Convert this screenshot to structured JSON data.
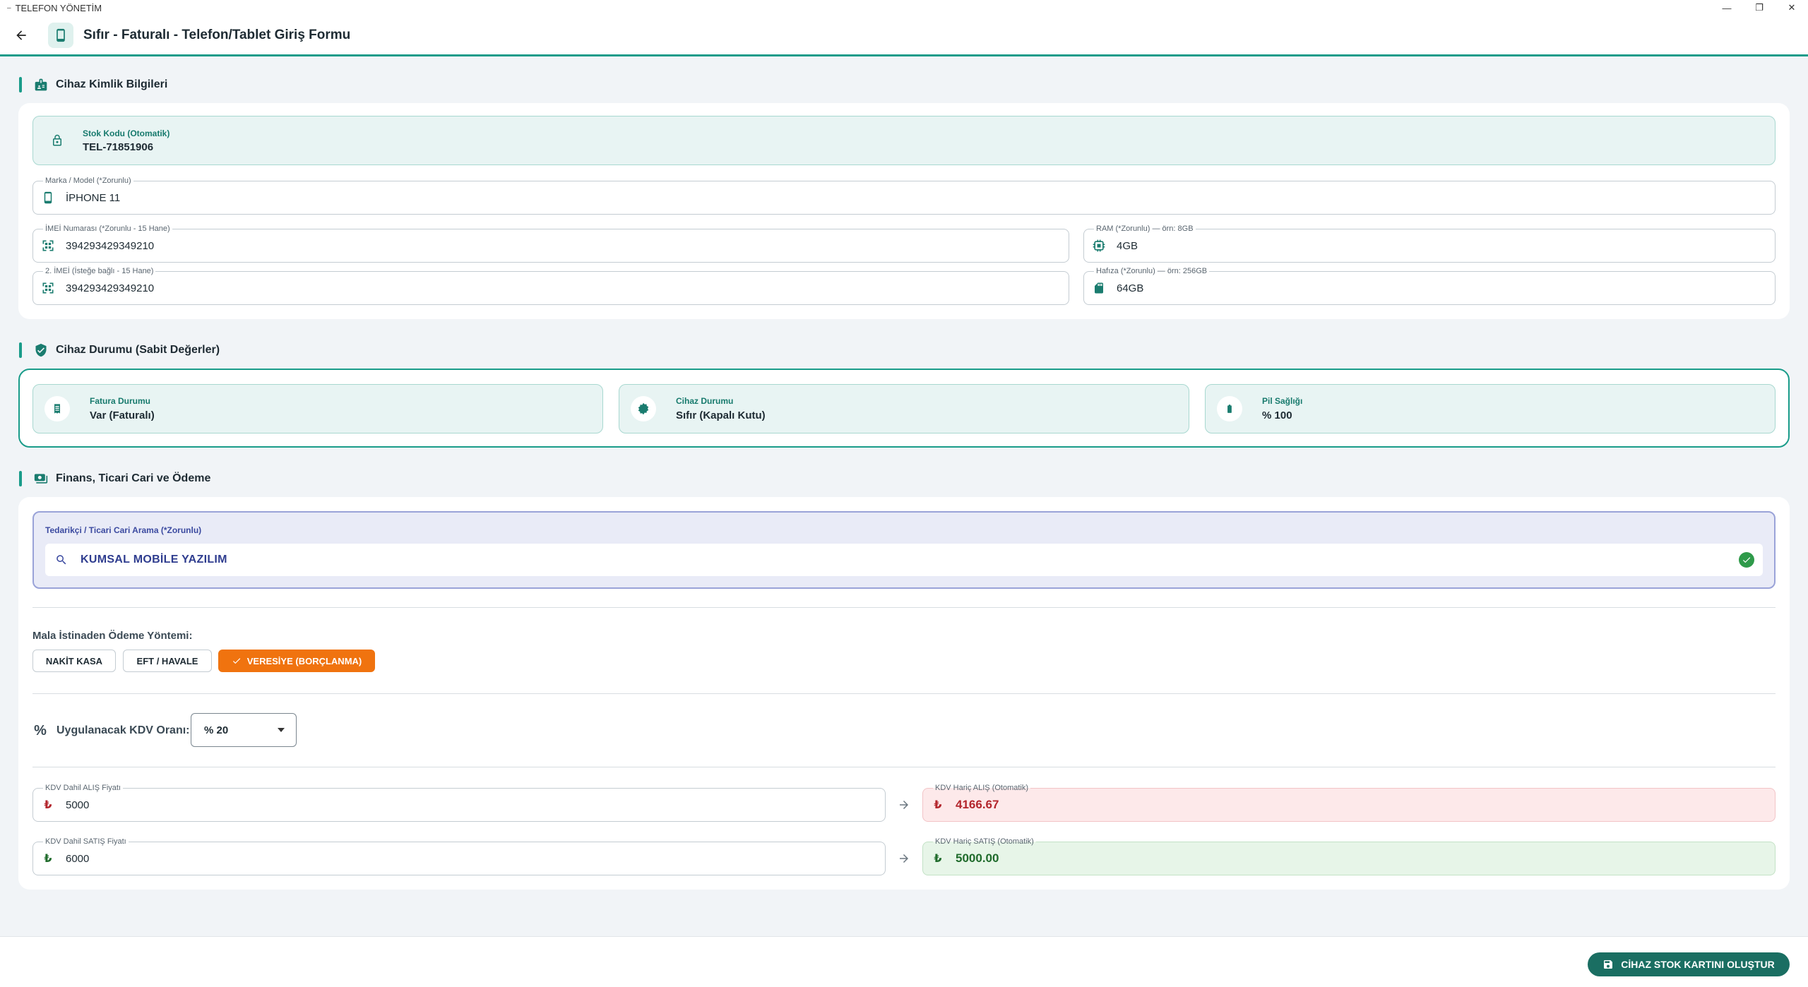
{
  "window": {
    "title": "TELEFON YÖNETİM",
    "controls": {
      "minimize": "—",
      "restore": "❐",
      "close": "✕"
    }
  },
  "header": {
    "title": "Sıfır - Faturalı - Telefon/Tablet Giriş Formu",
    "back_icon": "arrow-left-icon",
    "page_icon": "smartphone-icon"
  },
  "identity": {
    "title": "Cihaz Kimlik Bilgileri",
    "stock_code": {
      "label": "Stok Kodu (Otomatik)",
      "value": "TEL-71851906"
    },
    "brand_model": {
      "label": "Marka / Model (*Zorunlu)",
      "value": "İPHONE 11"
    },
    "imei1": {
      "label": "İMEİ Numarası (*Zorunlu - 15 Hane)",
      "value": "394293429349210"
    },
    "imei2": {
      "label": "2. İMEİ (İsteğe bağlı - 15 Hane)",
      "value": "394293429349210"
    },
    "ram": {
      "label": "RAM (*Zorunlu) — örn: 8GB",
      "value": "4GB"
    },
    "storage": {
      "label": "Hafıza (*Zorunlu) — örn: 256GB",
      "value": "64GB"
    }
  },
  "status": {
    "title": "Cihaz Durumu (Sabit Değerler)",
    "invoice": {
      "label": "Fatura Durumu",
      "value": "Var (Faturalı)"
    },
    "device": {
      "label": "Cihaz Durumu",
      "value": "Sıfır (Kapalı Kutu)"
    },
    "battery": {
      "label": "Pil Sağlığı",
      "value": "% 100"
    }
  },
  "finance": {
    "title": "Finans, Ticari Cari ve Ödeme",
    "supplier": {
      "label": "Tedarikçi / Ticari Cari Arama (*Zorunlu)",
      "value": "KUMSAL MOBİLE YAZILIM"
    },
    "payment_title": "Mala İstinaden Ödeme Yöntemi:",
    "payment_options": [
      "NAKİT KASA",
      "EFT / HAVALE",
      "VERESİYE (BORÇLANMA)"
    ],
    "payment_selected": "VERESİYE (BORÇLANMA)",
    "kdv_label": "Uygulanacak KDV Oranı:",
    "kdv_value": "% 20",
    "buy_incl": {
      "label": "KDV Dahil ALIŞ Fiyatı",
      "value": "5000"
    },
    "buy_excl": {
      "label": "KDV Hariç ALIŞ (Otomatik)",
      "value": "4166.67"
    },
    "sell_incl": {
      "label": "KDV Dahil SATIŞ Fiyatı",
      "value": "6000"
    },
    "sell_excl": {
      "label": "KDV Hariç SATIŞ (Otomatik)",
      "value": "5000.00"
    },
    "currency_symbol": "₺"
  },
  "footer": {
    "save_label": "CİHAZ STOK KARTINI OLUŞTUR"
  },
  "colors": {
    "accent": "#1a9c8a",
    "orange": "#f0730f",
    "red": "#b3262d",
    "green": "#1f6b2b",
    "indigo": "#3b4aa0"
  }
}
